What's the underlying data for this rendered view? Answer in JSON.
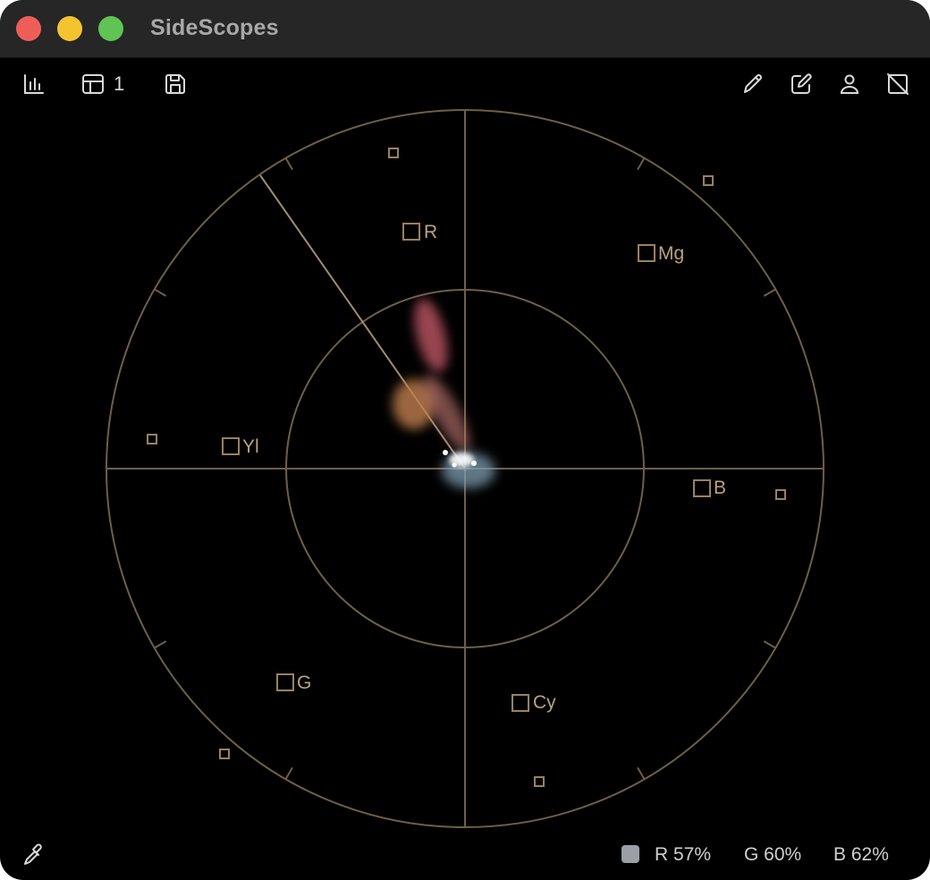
{
  "window": {
    "title": "SideScopes"
  },
  "toolbar": {
    "left": [
      {
        "name": "waveform-icon"
      },
      {
        "name": "layout-icon",
        "label": "1"
      },
      {
        "name": "save-icon"
      }
    ],
    "right": [
      {
        "name": "pencil-icon"
      },
      {
        "name": "edit-icon"
      },
      {
        "name": "person-icon"
      },
      {
        "name": "no-frame-icon"
      }
    ]
  },
  "vectorscope": {
    "targets": [
      {
        "label": "R"
      },
      {
        "label": "Mg"
      },
      {
        "label": "B"
      },
      {
        "label": "Cy"
      },
      {
        "label": "G"
      },
      {
        "label": "Yl"
      }
    ],
    "colors": {
      "graticule": "#6e5f46",
      "target": "#9a8160",
      "skin_line": "#a08c72"
    }
  },
  "status": {
    "swatch_color": "#9aa0a6",
    "r": "R 57%",
    "g": "G 60%",
    "b": "B 62%"
  }
}
